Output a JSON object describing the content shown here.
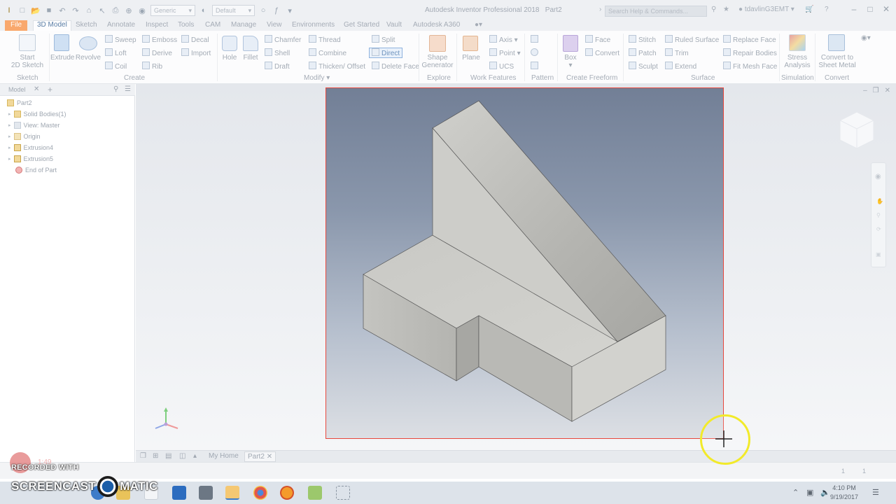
{
  "titlebar": {
    "title": "Autodesk Inventor Professional 2018",
    "document": "Part2",
    "material_value": "Generic",
    "appearance_value": "Default",
    "search_placeholder": "Search Help & Commands...",
    "user": "tdavlinG3EMT"
  },
  "tabs": [
    "File",
    "3D Model",
    "Sketch",
    "Annotate",
    "Inspect",
    "Tools",
    "CAM",
    "Manage",
    "View",
    "Environments",
    "Get Started",
    "Vault",
    "Autodesk A360"
  ],
  "ribbon": {
    "sketch": {
      "start_sketch": "Start",
      "start_sketch_2": "2D Sketch",
      "label": "Sketch"
    },
    "create": {
      "extrude": "Extrude",
      "revolve": "Revolve",
      "sweep": "Sweep",
      "loft": "Loft",
      "coil": "Coil",
      "emboss": "Emboss",
      "derive": "Derive",
      "rib": "Rib",
      "decal": "Decal",
      "import": "Import",
      "label": "Create"
    },
    "modify": {
      "hole": "Hole",
      "fillet": "Fillet",
      "chamfer": "Chamfer",
      "shell": "Shell",
      "draft": "Draft",
      "thread": "Thread",
      "combine": "Combine",
      "thicken_offset": "Thicken/ Offset",
      "split": "Split",
      "direct": "Direct",
      "delete_face": "Delete Face",
      "label": "Modify"
    },
    "explore": {
      "shape_generator": "Shape",
      "shape_generator_2": "Generator",
      "label": "Explore"
    },
    "work_features": {
      "plane": "Plane",
      "axis": "Axis",
      "point": "Point",
      "ucs": "UCS",
      "label": "Work Features"
    },
    "pattern": {
      "label": "Pattern"
    },
    "create_freeform": {
      "box": "Box",
      "face": "Face",
      "convert": "Convert",
      "label": "Create Freeform"
    },
    "surface": {
      "stitch": "Stitch",
      "patch": "Patch",
      "sculpt": "Sculpt",
      "ruled_surface": "Ruled Surface",
      "trim": "Trim",
      "extend": "Extend",
      "replace_face": "Replace Face",
      "repair_bodies": "Repair Bodies",
      "fit_mesh_face": "Fit Mesh Face",
      "label": "Surface"
    },
    "simulation": {
      "stress_analysis": "Stress",
      "stress_analysis_2": "Analysis",
      "label": "Simulation"
    },
    "convert": {
      "sheet_metal": "Convert to",
      "sheet_metal_2": "Sheet Metal",
      "label": "Convert"
    }
  },
  "browser": {
    "tab": "Model",
    "items": [
      "Part2",
      "Solid Bodies(1)",
      "View: Master",
      "Origin",
      "Extrusion4",
      "Extrusion5",
      "End of Part"
    ]
  },
  "doctabs": {
    "home": "My Home",
    "part": "Part2"
  },
  "status": {
    "left": "1",
    "right": "1"
  },
  "taskbar": {
    "time": "4:10 PM",
    "date": "9/19/2017"
  },
  "watermark": {
    "timer": "1:49",
    "recorded": "RECORDED WITH",
    "brand_a": "SCREENCAST",
    "brand_b": "MATIC"
  },
  "colors": {
    "file_tab": "#f9a86d",
    "viewport_border": "#e8473d",
    "cursor_ring": "#f2ea2a"
  }
}
